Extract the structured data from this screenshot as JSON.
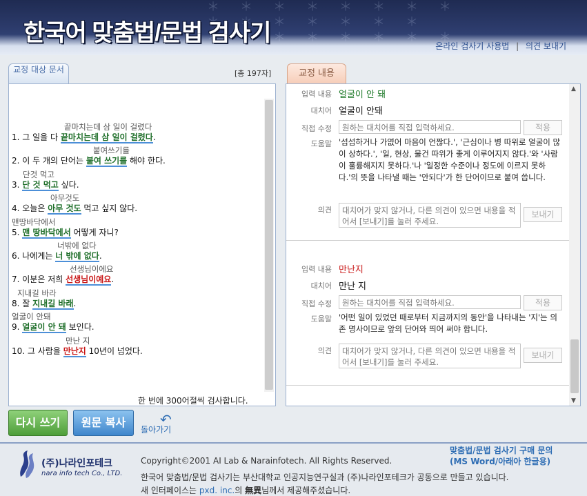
{
  "header": {
    "title": "한국어 맞춤법/문법 검사기",
    "links": [
      "온라인 검사기 사용법",
      "의견 보내기"
    ],
    "link_sep": "|"
  },
  "left": {
    "tab": "교정 대상 문서",
    "count": "[총 197자]",
    "sentences": [
      {
        "sugg": "끝마치는데 삼 일이 걸렸다",
        "pre": "1. 그 일을 다 ",
        "mark": "끝마치는데 삼 일이 걸렸다",
        "post": ".",
        "tone": "g"
      },
      {
        "sugg": "붙여쓰기를",
        "pre": "2. 이 두 개의 단어는 ",
        "mark": "붙여 쓰기를",
        "post": " 해야 한다.",
        "tone": "g"
      },
      {
        "sugg": "단것 먹고",
        "pre": "3. ",
        "mark": "단 것 먹고",
        "post": " 싶다.",
        "tone": "g"
      },
      {
        "sugg": "아무것도",
        "pre": "4. 오늘은 ",
        "mark": "아무 것도",
        "post": " 먹고 싶지 않다.",
        "tone": "g"
      },
      {
        "sugg": "맨땅바닥에서",
        "pre": "5. ",
        "mark": "맨 땅바닥에서",
        "post": " 어떻게 자니?",
        "tone": "g"
      },
      {
        "sugg": "너밖에 없다",
        "pre": "6. 나에게는 ",
        "mark": "너 밖에 없다",
        "post": ".",
        "tone": "g"
      },
      {
        "sugg": "선생님이에요",
        "pre": "7. 이분은 저희 ",
        "mark": "선생님이예요",
        "post": ".",
        "tone": "r"
      },
      {
        "sugg": "지내길 바라",
        "pre": "8. 잘 ",
        "mark": "지내길 바래",
        "post": ".",
        "tone": "g"
      },
      {
        "sugg": "얼굴이 안돼",
        "pre": "9. ",
        "mark": "얼굴이 안 돼",
        "post": " 보인다.",
        "tone": "g"
      },
      {
        "sugg": "만난 지",
        "pre": "10. 그 사람을 ",
        "mark": "만난지",
        "post": " 10년이 넘었다.",
        "tone": "r"
      }
    ],
    "footer": "한 번에 300어절씩 검사합니다."
  },
  "right": {
    "tab": "교정 내용",
    "labels": {
      "input": "입력 내용",
      "replace": "대치어",
      "direct": "직접 수정",
      "help": "도움말",
      "opinion": "의견"
    },
    "direct_placeholder": "원하는 대치어를 직접 입력하세요.",
    "apply_label": "적용",
    "opinion_placeholder": "대치어가 맞지 않거나, 다른 의견이 있으면 내용을 적어서 [보내기]를 눌러 주세요.",
    "send_label": "보내기",
    "cards": [
      {
        "input": "얼굴이 안 돼",
        "input_color": "#1f7a2a",
        "replace": "얼굴이 안돼",
        "help": "'섭섭하거나 가엾어 마음이 언짢다.', '근심이나 병 따위로 얼굴이 많이 상하다.', '일, 현상, 물건 따위가 좋게 이루어지지 않다.'와 '사람이 훌륭해지지 못하다.'나 '일정한 수준이나 정도에 이르지 못하다.'의 뜻을 나타낼 때는 '안되다'가 한 단어이므로 붙여 씁니다."
      },
      {
        "input": "만난지",
        "input_color": "#c91818",
        "replace": "만난 지",
        "help": "'어떤 일이 있었던 때로부터 지금까지의 동안'을 나타내는 '지'는 의존 명사이므로 앞의 단어와 띄어 써야 합니다."
      }
    ]
  },
  "buttons": {
    "rewrite": "다시 쓰기",
    "copy": "원문 복사",
    "back": "돌아가기"
  },
  "footer": {
    "logo_ko": "(주)나라인포테크",
    "logo_en": "nara info tech Co., LTD.",
    "copyright": "Copyright©2001 AI Lab & Narainfotech. All Rights Reserved.",
    "desc": "한국어 맞춤법/문법 검사기는 부산대학교 인공지능연구실과 (주)나라인포테크가 공동으로 만들고 있습니다.",
    "credit_pre": "새 인터페이스는 ",
    "credit_link": "pxd. inc.",
    "credit_mid": "의 ",
    "credit_bold": "無異",
    "credit_post": "님께서 제공해주셨습니다.",
    "purchase_line1": "맞춤법/문법 검사기 구매 문의",
    "purchase_line2": "(MS Word/아래아 한글용)"
  },
  "colors": {
    "header_bg": "#2c3b6b",
    "accent": "#2e6db4",
    "mark_green": "#1f6f2a",
    "mark_red": "#c91818",
    "rewrite_btn": "#5aa845",
    "copy_btn": "#4a90d2"
  }
}
